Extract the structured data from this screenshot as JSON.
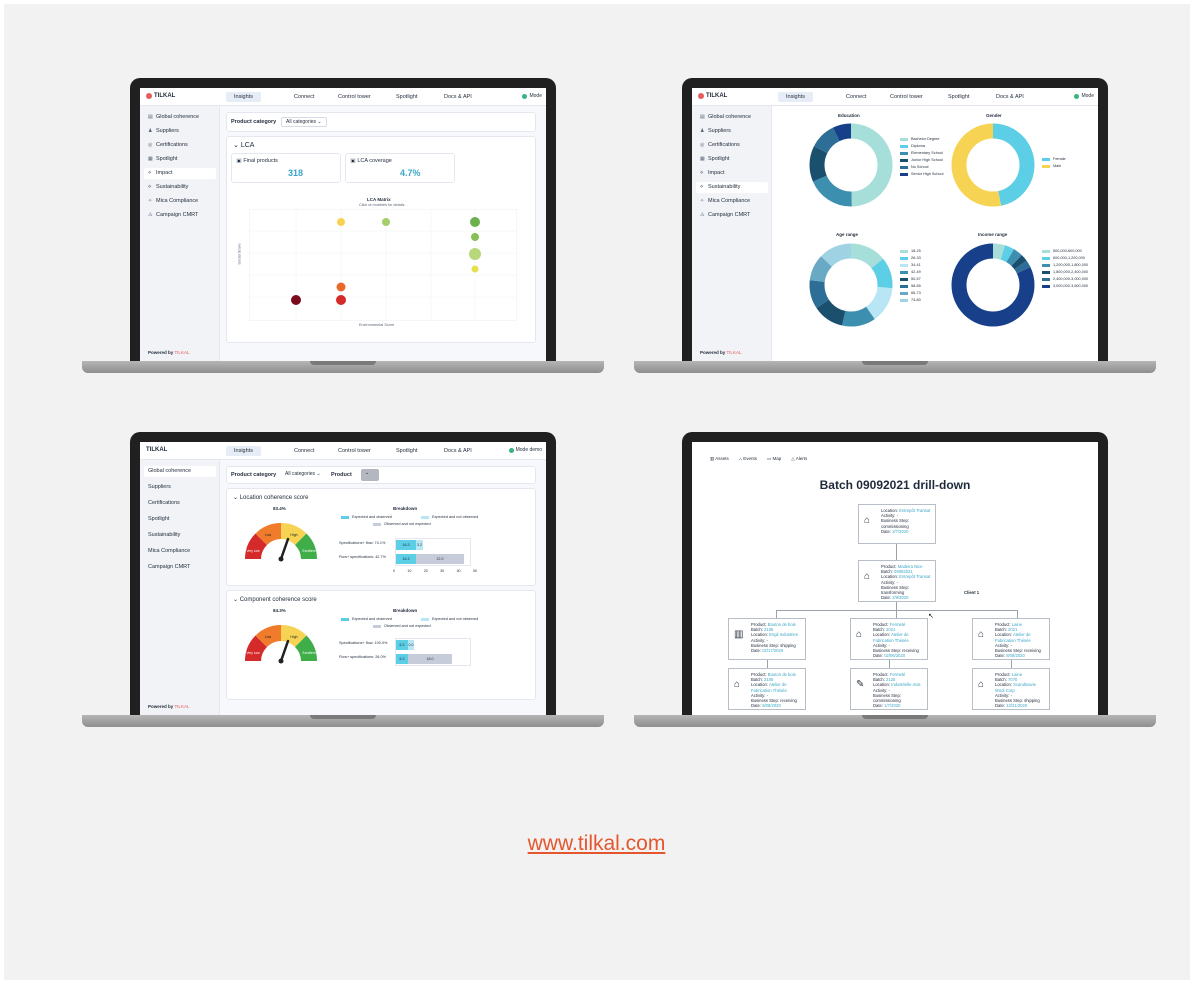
{
  "colors": {
    "accent": "#e4572e",
    "teal": "#5ccfe6",
    "navy": "#173f8a",
    "yellow": "#f7d354",
    "red": "#d52a2a"
  },
  "footer_url": "www.tilkal.com",
  "app": {
    "brand": "TILKAL",
    "nav_tabs": [
      "Insights",
      "Connect",
      "Control tower",
      "Spotlight",
      "Docs & API"
    ],
    "mode_label": "Mode",
    "mode_label_full": "Mode demo",
    "sidebar_items": [
      "Global coherence",
      "Suppliers",
      "Certifications",
      "Spotlight",
      "Impact",
      "Sustainability",
      "Mica Compliance",
      "Campaign CMRT"
    ],
    "sidebar_icons": [
      "doc-icon",
      "suppliers-icon",
      "certifications-icon",
      "spotlight-icon",
      "impact-icon",
      "sustainability-icon",
      "mica-icon",
      "campaign-icon"
    ],
    "powered_by": "Powered by",
    "powered_brand": "TILKAL"
  },
  "screen1": {
    "active_sidebar": "Impact",
    "filter_label": "Product category",
    "filter_value": "All categories",
    "section_title": "LCA",
    "kpi1_label": "Final products",
    "kpi1_value": "318",
    "kpi2_label": "LCA coverage",
    "kpi2_value": "4.7%",
    "chart_title": "LCA Matrix",
    "chart_subtitle": "Click on bubbles for details",
    "ylabel": "Social Score",
    "xlabel": "Environmental Score"
  },
  "screen2": {
    "active_sidebar": "Sustainability",
    "donut_titles": [
      "Education",
      "Gender",
      "Age range",
      "Income range"
    ],
    "education_legend": [
      "Bachelor Degree",
      "Diploma",
      "Elementary School",
      "Junior High School",
      "No School",
      "Senior High School"
    ],
    "gender_legend": [
      "Female",
      "Male"
    ],
    "age_legend": [
      "18-25",
      "26-33",
      "34-41",
      "42-49",
      "50-57",
      "58-65",
      "66-73",
      "74-80"
    ],
    "income_legend": [
      "500,000-600,000",
      "600,000-1,200,000",
      "1,200,000-1,800,000",
      "1,800,000-2,400,000",
      "2,400,000-3,000,000",
      "3,000,000-3,600,000"
    ]
  },
  "screen3": {
    "active_sidebar": "Global coherence",
    "filter_label": "Product category",
    "filter_value": "All categories",
    "filter2_label": "Product",
    "section1_title": "Location coherence score",
    "section1_score": "83.4%",
    "section2_title": "Component coherence score",
    "section2_score": "84.3%",
    "breakdown_title": "Breakdown",
    "legend": [
      "Expected and observed",
      "Expected and not observed",
      "Observed and not expected"
    ],
    "gauge_labels": [
      "Very Low",
      "Low",
      "High",
      "Excellent"
    ],
    "row1_labels": [
      "Specifications+ flow: 74.1%",
      "Flow+ specifications: 42.7%"
    ],
    "row1_values": [
      [
        "16.3",
        "3.2"
      ],
      [
        "16.3",
        "22.0"
      ]
    ],
    "row2_labels": [
      "Specifications+ flow: 100.0%",
      "Flow+ specifications: 26.0%"
    ],
    "row2_values": [
      [
        "6.3",
        "0.0"
      ],
      [
        "6.3",
        "18.0"
      ]
    ],
    "axis_ticks": [
      "0",
      "10",
      "20",
      "30",
      "40",
      "50"
    ]
  },
  "screen4": {
    "tabs": [
      "Assets",
      "Events",
      "Map",
      "Alerts"
    ],
    "title": "Batch 09092021 drill-down",
    "client_label": "Client 1",
    "nodes": [
      {
        "l1": "Location:",
        "v1": "Entrepôt Transat",
        "l2": "Activity: -",
        "l3": "Business Step: commissioning",
        "l4": "Date:",
        "v4": "2/7/2020"
      },
      {
        "l1": "Product:",
        "v1": "Madeira Nice",
        "l2": "Batch:",
        "v2": "09092021",
        "l3": "Location:",
        "v3": "Entrepôt Transat",
        "l4": "Activity: -",
        "l5": "Business Step: transforming",
        "l6": "Date:",
        "v6": "2/9/2020"
      },
      {
        "l1": "Product:",
        "v1": "Bouton de bois",
        "l2": "Batch:",
        "v2": "2105",
        "l3": "Location:",
        "v3": "Engil Industries",
        "l4": "Activity: -",
        "l5": "Business Step: shipping",
        "l6": "Date:",
        "v6": "02/17/2020"
      },
      {
        "l1": "Product:",
        "v1": "Fermeté",
        "l2": "Batch:",
        "v2": "2021",
        "l3": "Location:",
        "v3": "Atelier de Fabrication Thésée",
        "l4": "Activity: -",
        "l5": "Business Step: receiving",
        "l6": "Date:",
        "v6": "02/06/2020"
      },
      {
        "l1": "Product:",
        "v1": "Laine",
        "l2": "Batch:",
        "v2": "2021",
        "l3": "Location:",
        "v3": "Atelier de Fabrication Thésée",
        "l4": "Activity: -",
        "l5": "Business Step: receiving",
        "l6": "Date:",
        "v6": "8/08/2020"
      },
      {
        "l1": "Product:",
        "v1": "Bouton de bois",
        "l2": "Batch:",
        "v2": "2105",
        "l3": "Location:",
        "v3": "Atelier de Fabrication Thésée",
        "l4": "Activity: -",
        "l5": "Business Step: receiving",
        "l6": "Date:",
        "v6": "8/08/2020"
      },
      {
        "l1": "Product:",
        "v1": "Fermeté",
        "l2": "Batch:",
        "v2": "2125",
        "l3": "Location:",
        "v3": "Industrielle Anis",
        "l4": "Activity: -",
        "l5": "Business Step: commissioning",
        "l6": "Date:",
        "v6": "1/7/2020"
      },
      {
        "l1": "Product:",
        "v1": "Laine",
        "l2": "Batch:",
        "v2": "7070",
        "l3": "Location:",
        "v3": "Scandinavie Wool Corp",
        "l4": "Activity: -",
        "l5": "Business Step: shipping",
        "l6": "Date:",
        "v6": "12/21/2020"
      }
    ]
  }
}
